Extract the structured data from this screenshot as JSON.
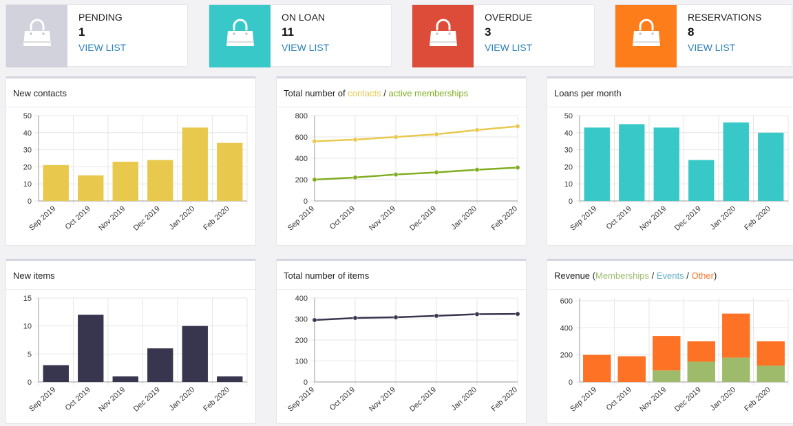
{
  "colors": {
    "pending": "#d2d2dc",
    "on_loan": "#37c8c7",
    "overdue": "#dd4b39",
    "reservations": "#fd7d1b",
    "link": "#2a80b9",
    "yellow": "#e8c84d",
    "green": "#7fad1f",
    "teal": "#37c8c7",
    "navy": "#38354f",
    "memberships": "#9dbb6b",
    "events": "#5fb0c9",
    "other": "#fd7224"
  },
  "stats": [
    {
      "label": "PENDING",
      "count": "1",
      "link": "VIEW LIST",
      "icon": "shopping-bag-icon"
    },
    {
      "label": "ON LOAN",
      "count": "11",
      "link": "VIEW LIST",
      "icon": "shopping-bag-icon"
    },
    {
      "label": "OVERDUE",
      "count": "3",
      "link": "VIEW LIST",
      "icon": "shopping-bag-icon"
    },
    {
      "label": "RESERVATIONS",
      "count": "8",
      "link": "VIEW LIST",
      "icon": "shopping-bag-icon"
    }
  ],
  "panels": {
    "new_contacts": {
      "title": "New contacts"
    },
    "totals": {
      "title_prefix": "Total number of ",
      "title_contacts": "contacts",
      "title_sep": " / ",
      "title_memberships": "active memberships"
    },
    "loans": {
      "title": "Loans per month"
    },
    "new_items": {
      "title": "New items"
    },
    "total_items": {
      "title": "Total number of items"
    },
    "revenue": {
      "title_prefix": "Revenue (",
      "title_memberships": "Memberships",
      "title_sep1": " / ",
      "title_events": "Events",
      "title_sep2": " / ",
      "title_other": "Other",
      "title_suffix": ")"
    }
  },
  "chart_data": [
    {
      "id": "new_contacts",
      "type": "bar",
      "categories": [
        "Sep 2019",
        "Oct 2019",
        "Nov 2019",
        "Dec 2019",
        "Jan 2020",
        "Feb 2020"
      ],
      "values": [
        21,
        15,
        23,
        24,
        43,
        34
      ],
      "ylim": [
        0,
        50
      ],
      "yticks": [
        0,
        10,
        20,
        30,
        40,
        50
      ],
      "color": "#e8c84d"
    },
    {
      "id": "totals",
      "type": "line",
      "categories": [
        "Sep 2019",
        "Oct 2019",
        "Nov 2019",
        "Dec 2019",
        "Jan 2020",
        "Feb 2020"
      ],
      "series": [
        {
          "name": "contacts",
          "values": [
            560,
            575,
            600,
            625,
            665,
            700
          ],
          "color": "#e8c84d"
        },
        {
          "name": "active memberships",
          "values": [
            200,
            220,
            248,
            268,
            293,
            313
          ],
          "color": "#7fad1f"
        }
      ],
      "ylim": [
        0,
        800
      ],
      "yticks": [
        0,
        200,
        400,
        600,
        800
      ]
    },
    {
      "id": "loans",
      "type": "bar",
      "categories": [
        "Sep 2019",
        "Oct 2019",
        "Nov 2019",
        "Dec 2019",
        "Jan 2020",
        "Feb 2020"
      ],
      "values": [
        43,
        45,
        43,
        24,
        46,
        40
      ],
      "ylim": [
        0,
        50
      ],
      "yticks": [
        0,
        10,
        20,
        30,
        40,
        50
      ],
      "color": "#37c8c7"
    },
    {
      "id": "new_items",
      "type": "bar",
      "categories": [
        "Sep 2019",
        "Oct 2019",
        "Nov 2019",
        "Dec 2019",
        "Jan 2020",
        "Feb 2020"
      ],
      "values": [
        3,
        12,
        1,
        6,
        10,
        1
      ],
      "ylim": [
        0,
        15
      ],
      "yticks": [
        0,
        5,
        10,
        15
      ],
      "color": "#38354f"
    },
    {
      "id": "total_items",
      "type": "line",
      "categories": [
        "Sep 2019",
        "Oct 2019",
        "Nov 2019",
        "Dec 2019",
        "Jan 2020",
        "Feb 2020"
      ],
      "series": [
        {
          "name": "items",
          "values": [
            295,
            305,
            308,
            315,
            323,
            324
          ],
          "color": "#38354f"
        }
      ],
      "ylim": [
        0,
        400
      ],
      "yticks": [
        0,
        100,
        200,
        300,
        400
      ]
    },
    {
      "id": "revenue",
      "type": "bar",
      "stacked": true,
      "categories": [
        "Sep 2019",
        "Oct 2019",
        "Nov 2019",
        "Dec 2019",
        "Jan 2020",
        "Feb 2020"
      ],
      "series": [
        {
          "name": "Memberships",
          "values": [
            0,
            0,
            85,
            150,
            180,
            120
          ],
          "color": "#9dbb6b"
        },
        {
          "name": "Events",
          "values": [
            0,
            0,
            0,
            0,
            0,
            0
          ],
          "color": "#5fb0c9"
        },
        {
          "name": "Other",
          "values": [
            200,
            190,
            255,
            150,
            325,
            180
          ],
          "color": "#fd7224"
        }
      ],
      "ylim": [
        0,
        620
      ],
      "yticks": [
        0,
        200,
        400,
        600
      ]
    }
  ]
}
